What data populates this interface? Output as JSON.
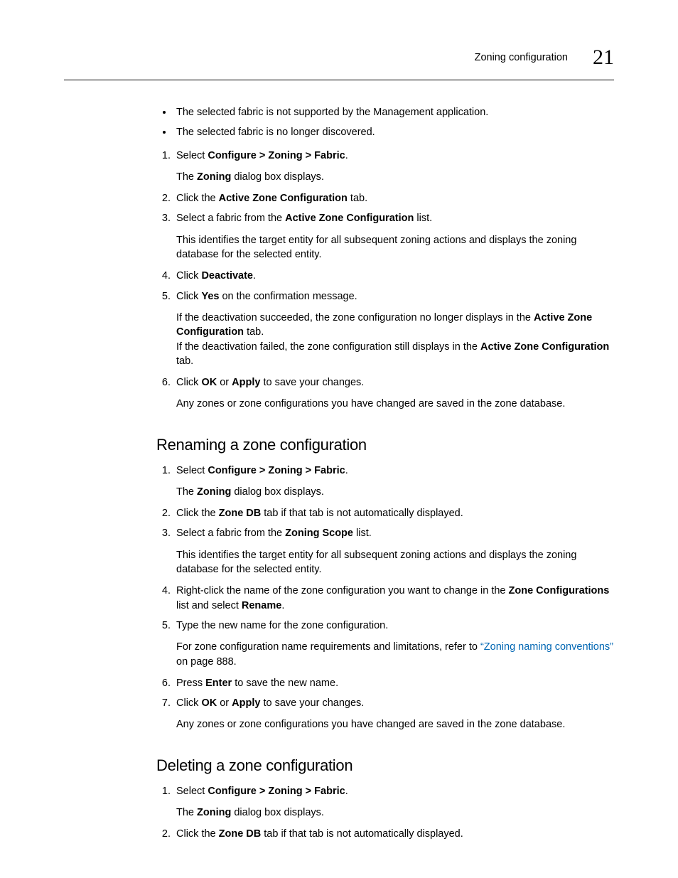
{
  "header": {
    "section": "Zoning configuration",
    "chapter": "21"
  },
  "bullets": [
    "The selected fabric is not supported by the Management application.",
    "The selected fabric is no longer discovered."
  ],
  "stepsA": {
    "s1_a": "Select ",
    "s1_b": "Configure > Zoning > Fabric",
    "s1_c": ".",
    "s1_note_a": "The ",
    "s1_note_b": "Zoning",
    "s1_note_c": " dialog box displays.",
    "s2_a": "Click the ",
    "s2_b": "Active Zone Configuration",
    "s2_c": " tab.",
    "s3_a": "Select a fabric from the ",
    "s3_b": "Active Zone Configuration",
    "s3_c": " list.",
    "s3_note": "This identifies the target entity for all subsequent zoning actions and displays the zoning database for the selected entity.",
    "s4_a": "Click ",
    "s4_b": "Deactivate",
    "s4_c": ".",
    "s5_a": "Click ",
    "s5_b": "Yes",
    "s5_c": " on the confirmation message.",
    "s5_note1_a": "If the deactivation succeeded, the zone configuration no longer displays in the ",
    "s5_note1_b": "Active Zone Configuration",
    "s5_note1_c": " tab.",
    "s5_note2_a": "If the deactivation failed, the zone configuration still displays in the ",
    "s5_note2_b": "Active Zone Configuration",
    "s5_note2_c": " tab.",
    "s6_a": "Click ",
    "s6_b": "OK",
    "s6_c": " or ",
    "s6_d": "Apply",
    "s6_e": " to save your changes.",
    "s6_note": "Any zones or zone configurations you have changed are saved in the zone database."
  },
  "heading_rename": "Renaming a zone configuration",
  "stepsB": {
    "s1_a": "Select ",
    "s1_b": "Configure > Zoning > Fabric",
    "s1_c": ".",
    "s1_note_a": "The ",
    "s1_note_b": "Zoning",
    "s1_note_c": " dialog box displays.",
    "s2_a": "Click the ",
    "s2_b": "Zone DB",
    "s2_c": " tab if that tab is not automatically displayed.",
    "s3_a": "Select a fabric from the ",
    "s3_b": "Zoning Scope",
    "s3_c": " list.",
    "s3_note": "This identifies the target entity for all subsequent zoning actions and displays the zoning database for the selected entity.",
    "s4_a": "Right-click the name of the zone configuration you want to change in the ",
    "s4_b": "Zone Configurations",
    "s4_c": " list and select ",
    "s4_d": "Rename",
    "s4_e": ".",
    "s5": "Type the new name for the zone configuration.",
    "s5_note_a": "For zone configuration name requirements and limitations, refer to ",
    "s5_link": "“Zoning naming conventions”",
    "s5_note_b": " on page 888.",
    "s6_a": "Press ",
    "s6_b": "Enter",
    "s6_c": " to save the new name.",
    "s7_a": "Click ",
    "s7_b": "OK",
    "s7_c": " or ",
    "s7_d": "Apply",
    "s7_e": " to save your changes.",
    "s7_note": "Any zones or zone configurations you have changed are saved in the zone database."
  },
  "heading_delete": "Deleting a zone configuration",
  "stepsC": {
    "s1_a": "Select ",
    "s1_b": "Configure > Zoning > Fabric",
    "s1_c": ".",
    "s1_note_a": "The ",
    "s1_note_b": "Zoning",
    "s1_note_c": " dialog box displays.",
    "s2_a": "Click the ",
    "s2_b": "Zone DB",
    "s2_c": " tab if that tab is not automatically displayed."
  }
}
